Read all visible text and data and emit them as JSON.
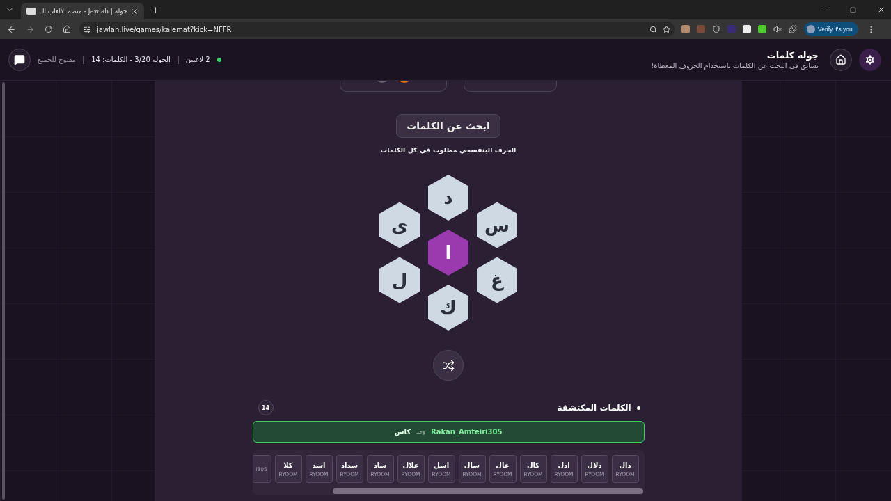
{
  "browser": {
    "tab_title": "جولة | Jawlah - منصة الألعاب الـ",
    "url": "jawlah.live/games/kalemat?kick=NFFR",
    "verify_button": "Verify it's you"
  },
  "header": {
    "title": "جوله كلمات",
    "subtitle": "تسابق في البحث عن الكلمات باستخدام الحروف المعطاة!",
    "players": "2 لاعبين",
    "round": "الجوله 3/20 - الكلمات: 14",
    "access": "مفتوح للجميع"
  },
  "game": {
    "heading": "ابحث عن الكلمات",
    "hint": "الحرف البنفسجي مطلوب في كل الكلمات",
    "letters": [
      {
        "letter": "د",
        "kind": "outer"
      },
      {
        "letter": "س",
        "kind": "outer"
      },
      {
        "letter": "غ",
        "kind": "outer"
      },
      {
        "letter": "ك",
        "kind": "outer"
      },
      {
        "letter": "ل",
        "kind": "outer"
      },
      {
        "letter": "ى",
        "kind": "outer"
      },
      {
        "letter": "ا",
        "kind": "center"
      }
    ]
  },
  "discovered": {
    "title": "الكلمات المكتشفة",
    "count": "14",
    "latest": {
      "player": "Rakan_Amteiri305",
      "verb": "وجد",
      "word": "كاس"
    },
    "words": [
      {
        "word": "دال",
        "player": "RYOOM"
      },
      {
        "word": "دلال",
        "player": "RYOOM"
      },
      {
        "word": "ادل",
        "player": "RYOOM"
      },
      {
        "word": "كال",
        "player": "RYOOM"
      },
      {
        "word": "غال",
        "player": "RYOOM"
      },
      {
        "word": "سال",
        "player": "RYOOM"
      },
      {
        "word": "اسل",
        "player": "RYOOM"
      },
      {
        "word": "غلال",
        "player": "RYOOM"
      },
      {
        "word": "ساد",
        "player": "RYOOM"
      },
      {
        "word": "سداد",
        "player": "RYOOM"
      },
      {
        "word": "اسد",
        "player": "RYOOM"
      },
      {
        "word": "كلا",
        "player": "RYOOM"
      },
      {
        "player": "i305"
      }
    ]
  }
}
